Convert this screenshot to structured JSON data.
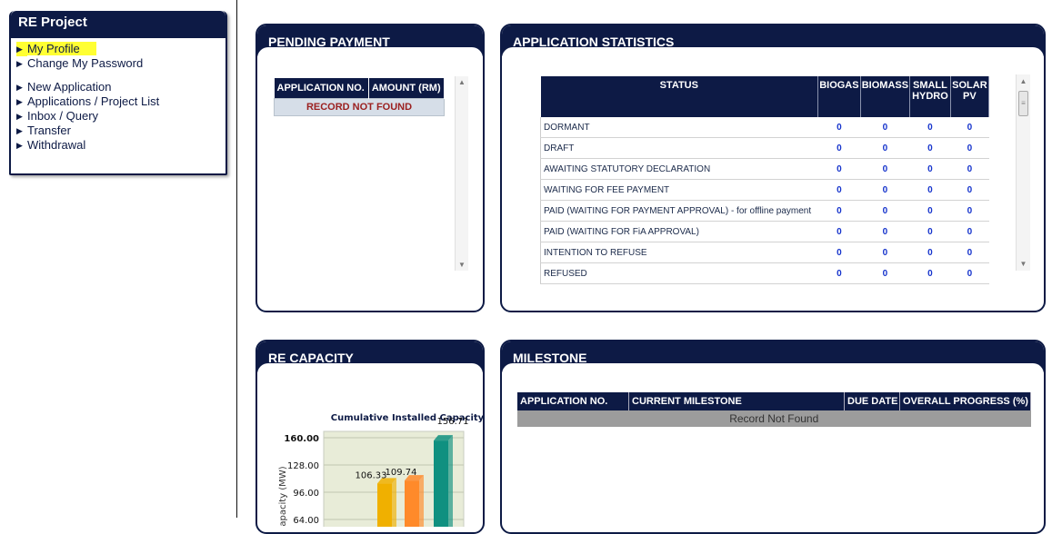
{
  "menu": {
    "title": "RE Project",
    "items": [
      {
        "label": "My Profile",
        "active": true
      },
      {
        "label": "Change My Password"
      },
      {
        "label": "New Application"
      },
      {
        "label": "Applications / Project List"
      },
      {
        "label": "Inbox / Query"
      },
      {
        "label": "Transfer"
      },
      {
        "label": "Withdrawal"
      }
    ]
  },
  "pending": {
    "title": "PENDING PAYMENT",
    "columns": [
      "APPLICATION NO.",
      "AMOUNT (RM)"
    ],
    "empty_text": "RECORD NOT FOUND"
  },
  "stats": {
    "title": "APPLICATION STATISTICS",
    "columns": [
      "STATUS",
      "BIOGAS",
      "BIOMASS",
      "SMALL HYDRO",
      "SOLAR PV"
    ],
    "rows": [
      {
        "status": "DORMANT",
        "values": [
          "0",
          "0",
          "0",
          "0"
        ]
      },
      {
        "status": "DRAFT",
        "values": [
          "0",
          "0",
          "0",
          "0"
        ]
      },
      {
        "status": "AWAITING STATUTORY DECLARATION",
        "values": [
          "0",
          "0",
          "0",
          "0"
        ]
      },
      {
        "status": "WAITING FOR FEE PAYMENT",
        "values": [
          "0",
          "0",
          "0",
          "0"
        ]
      },
      {
        "status": "PAID (WAITING FOR PAYMENT APPROVAL) - for offline payment",
        "values": [
          "0",
          "0",
          "0",
          "0"
        ]
      },
      {
        "status": "PAID (WAITING FOR FiA APPROVAL)",
        "values": [
          "0",
          "0",
          "0",
          "0"
        ]
      },
      {
        "status": "INTENTION TO REFUSE",
        "values": [
          "0",
          "0",
          "0",
          "0"
        ]
      },
      {
        "status": "REFUSED",
        "values": [
          "0",
          "0",
          "0",
          "0"
        ]
      }
    ]
  },
  "capacity": {
    "title": "RE CAPACITY"
  },
  "milestone": {
    "title": "MILESTONE",
    "columns": [
      "APPLICATION NO.",
      "CURRENT MILESTONE",
      "DUE DATE",
      "OVERALL PROGRESS (%)"
    ],
    "empty_text": "Record Not Found"
  },
  "chart_data": {
    "type": "bar",
    "title": "Cumulative Installed Capacity",
    "ylabel": "Capacity (MW)",
    "yticks": [
      "160.00",
      "128.00",
      "96.00",
      "64.00"
    ],
    "ylim": [
      0,
      160
    ],
    "values": [
      106.33,
      109.74,
      156.71
    ],
    "value_labels": [
      "106.33",
      "109.74",
      "156.71"
    ],
    "colors": [
      "#f0b000",
      "#ff8a2a",
      "#109080"
    ],
    "grid": true
  }
}
